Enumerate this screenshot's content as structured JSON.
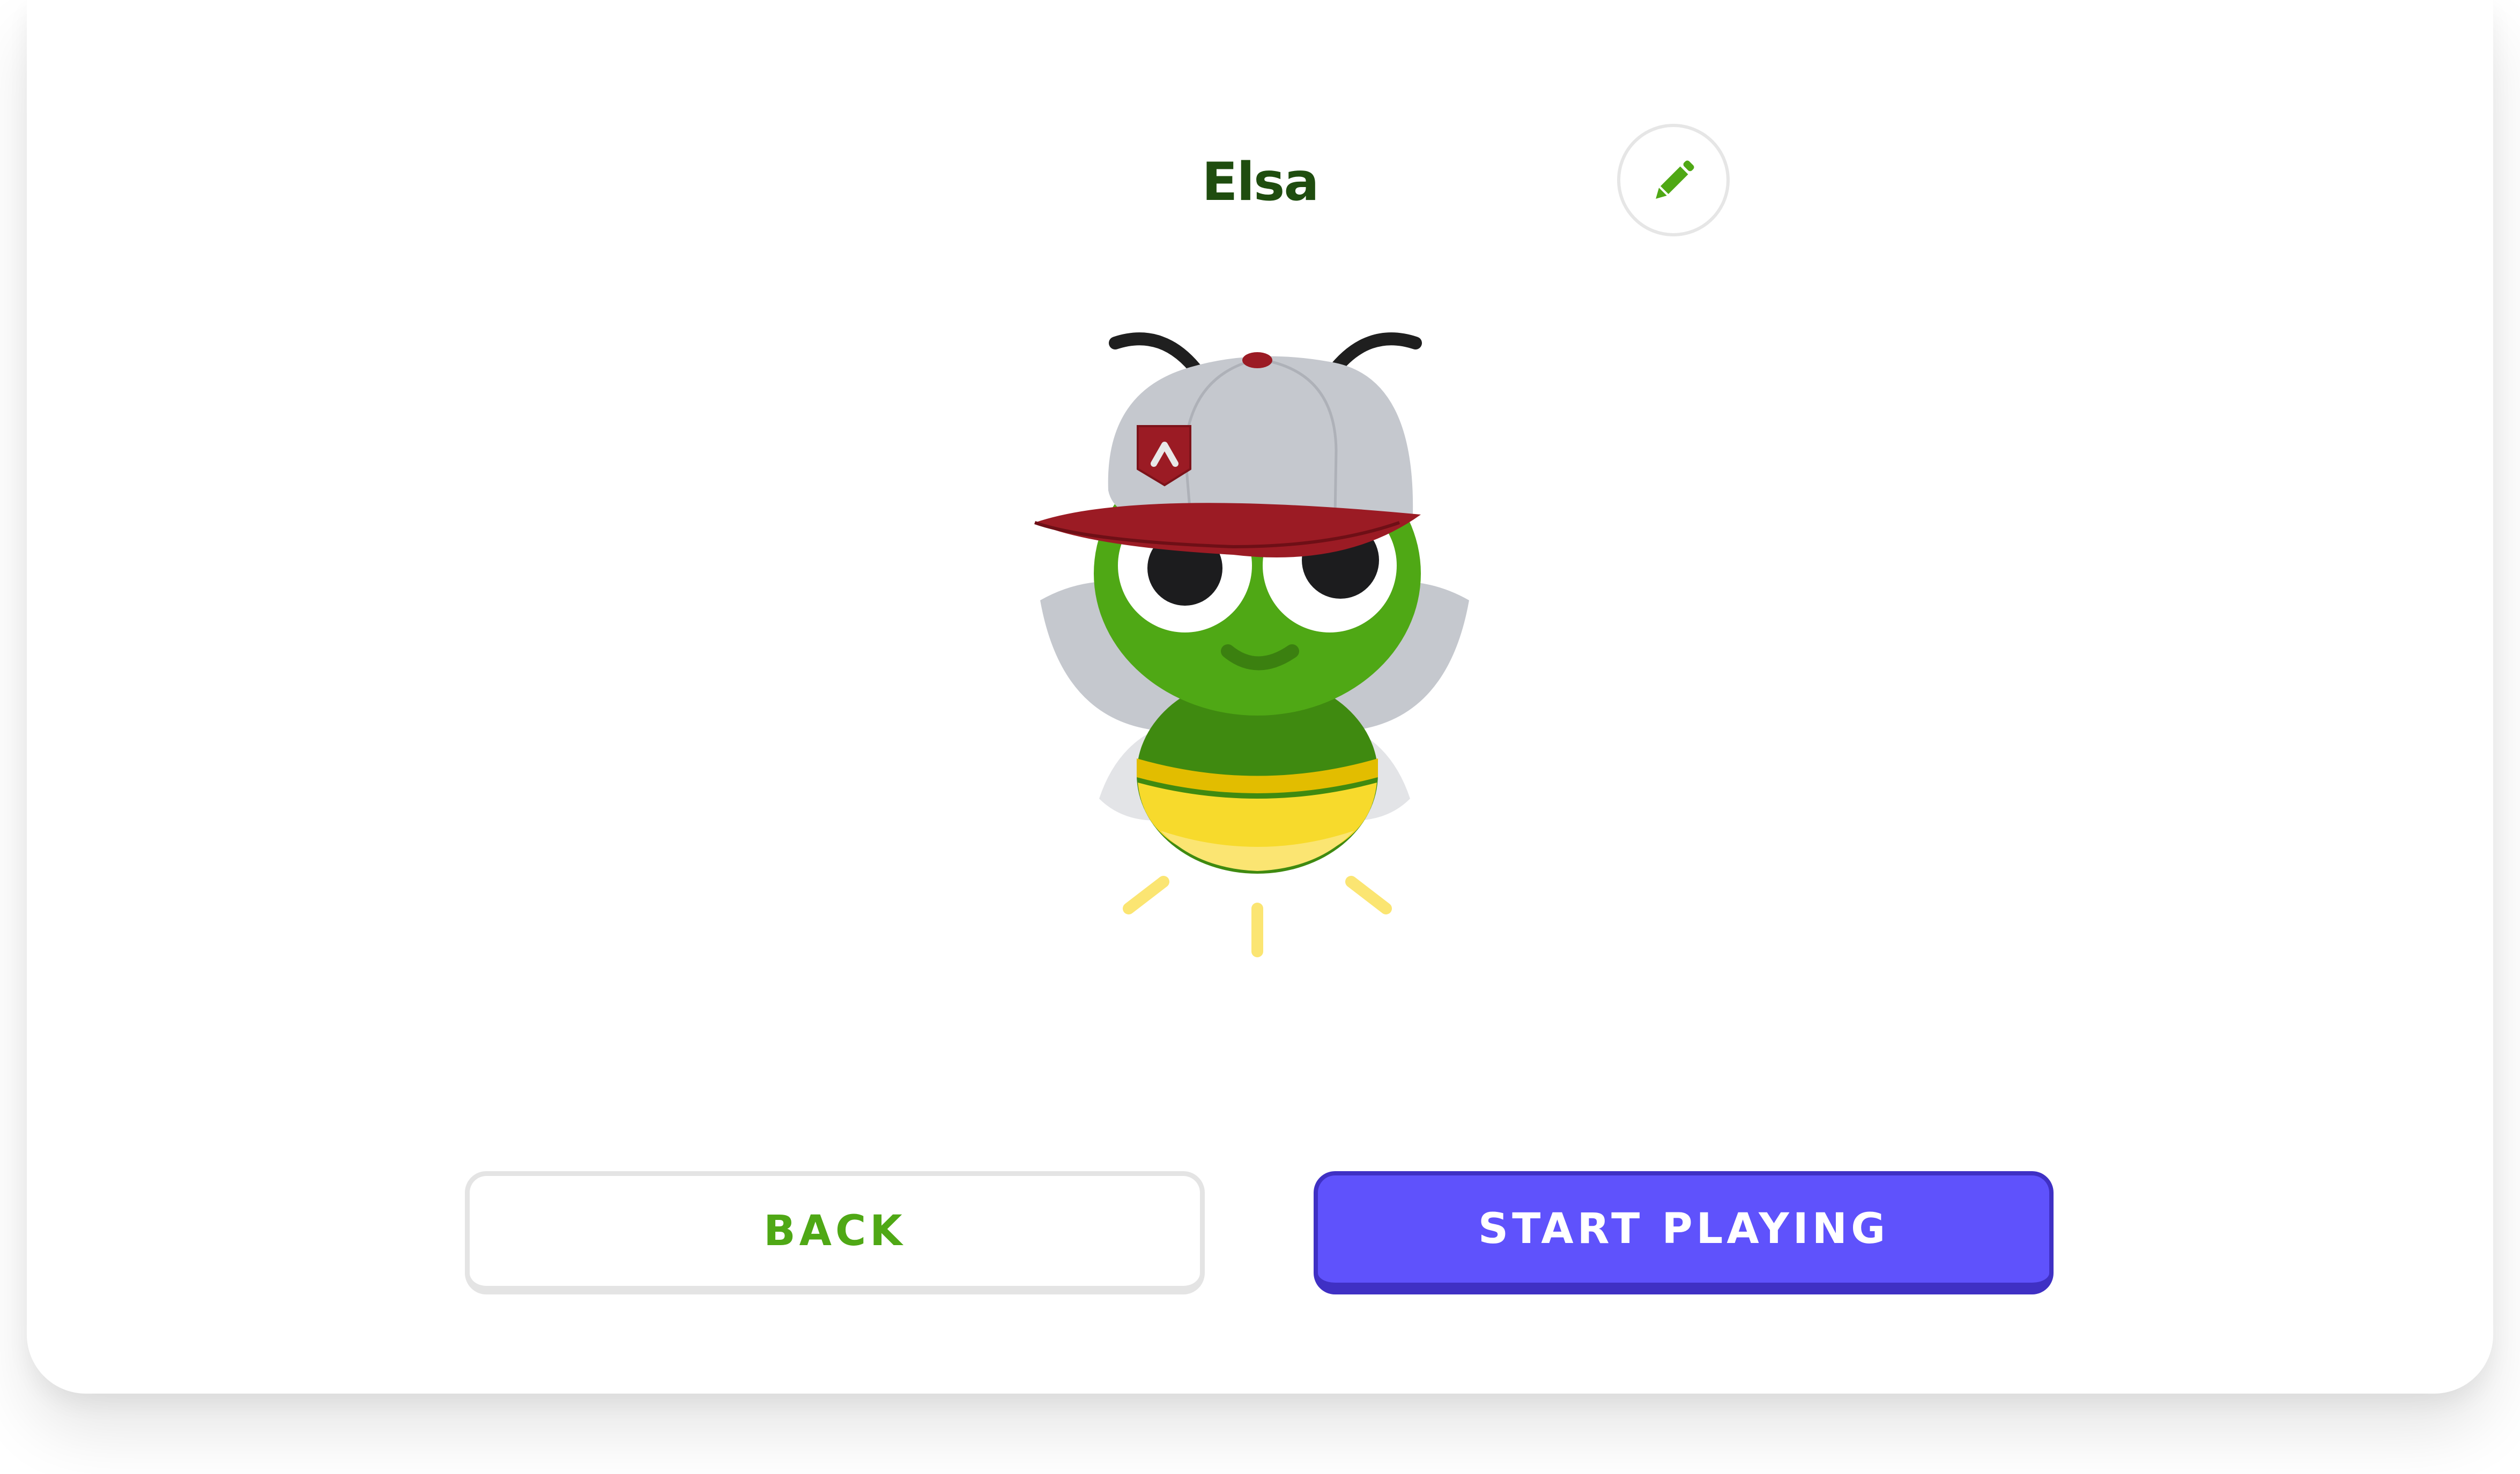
{
  "profile": {
    "name": "Elsa"
  },
  "icons": {
    "edit": "pencil-icon",
    "avatar": "bee-mascot-with-cap"
  },
  "actions": {
    "back_label": "BACK",
    "start_label": "START PLAYING"
  },
  "colors": {
    "name_text": "#1f4d0f",
    "back_text": "#4fa815",
    "primary_button": "#5f52fc",
    "primary_button_shadow": "#3f30c4",
    "pencil": "#4fa815"
  }
}
